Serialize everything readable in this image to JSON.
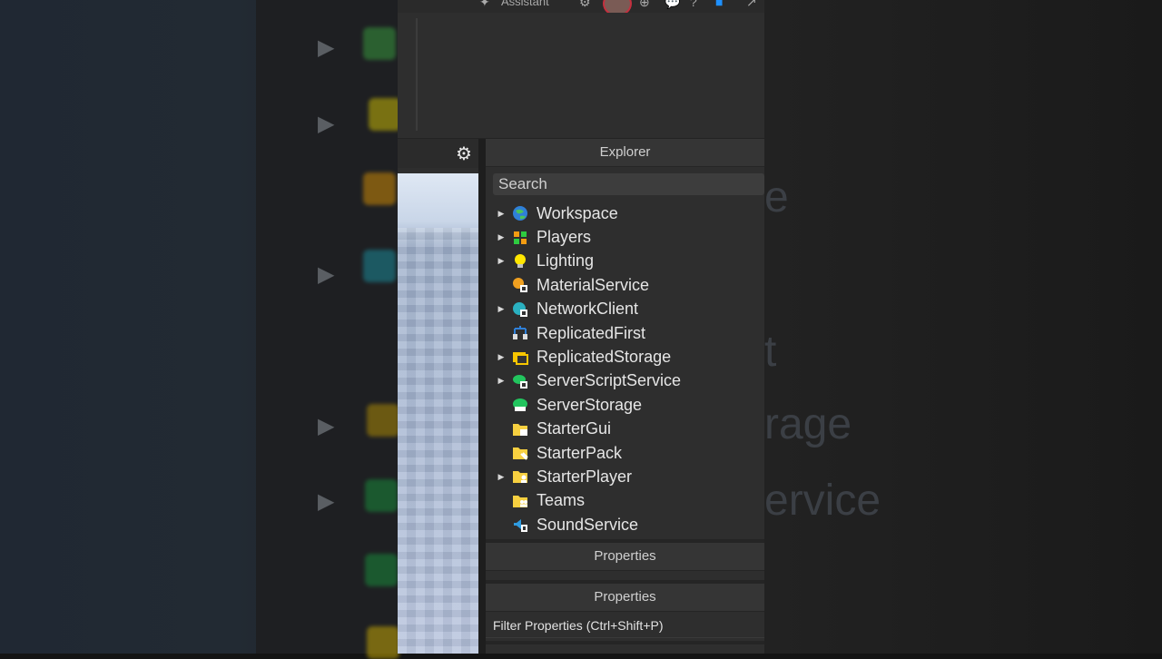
{
  "topbar": {
    "assistant_label": "Assistant"
  },
  "explorer": {
    "title": "Explorer",
    "search_placeholder": "Search",
    "items": [
      {
        "label": "Workspace",
        "expandable": true,
        "icon": "globe-icon"
      },
      {
        "label": "Players",
        "expandable": true,
        "icon": "players-icon"
      },
      {
        "label": "Lighting",
        "expandable": true,
        "icon": "lightbulb-icon"
      },
      {
        "label": "MaterialService",
        "expandable": false,
        "icon": "material-service-icon"
      },
      {
        "label": "NetworkClient",
        "expandable": true,
        "icon": "network-client-icon"
      },
      {
        "label": "ReplicatedFirst",
        "expandable": false,
        "icon": "replicated-first-icon"
      },
      {
        "label": "ReplicatedStorage",
        "expandable": true,
        "icon": "replicated-storage-icon"
      },
      {
        "label": "ServerScriptService",
        "expandable": true,
        "icon": "server-script-service-icon"
      },
      {
        "label": "ServerStorage",
        "expandable": false,
        "icon": "server-storage-icon"
      },
      {
        "label": "StarterGui",
        "expandable": false,
        "icon": "starter-gui-icon"
      },
      {
        "label": "StarterPack",
        "expandable": false,
        "icon": "starter-pack-icon"
      },
      {
        "label": "StarterPlayer",
        "expandable": true,
        "icon": "starter-player-icon"
      },
      {
        "label": "Teams",
        "expandable": false,
        "icon": "teams-icon"
      },
      {
        "label": "SoundService",
        "expandable": false,
        "icon": "sound-service-icon"
      }
    ]
  },
  "properties_top": {
    "title": "Properties"
  },
  "properties": {
    "title": "Properties",
    "filter_placeholder": "Filter Properties (Ctrl+Shift+P)"
  },
  "background_right": {
    "fragments": [
      "e",
      "t",
      "rage",
      "ervice"
    ]
  }
}
